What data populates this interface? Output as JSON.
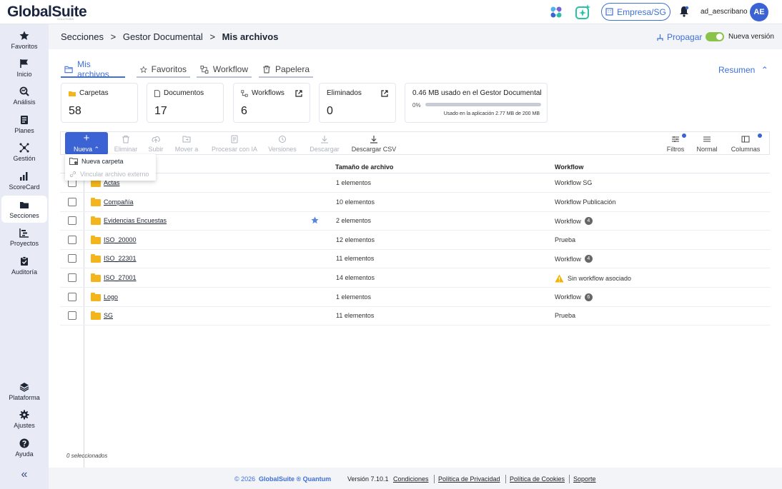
{
  "app": {
    "logo": "GlobalSuite",
    "logo_sub": "SOLUTIONS"
  },
  "topbar": {
    "empresa_label": "Empresa/SG",
    "username": "ad_aescribano",
    "avatar_initials": "AE"
  },
  "sidebar": {
    "items": [
      {
        "label": "Favoritos",
        "icon": "star-icon"
      },
      {
        "label": "Inicio",
        "icon": "flag-icon"
      },
      {
        "label": "Análisis",
        "icon": "analysis-icon"
      },
      {
        "label": "Planes",
        "icon": "plans-icon"
      },
      {
        "label": "Gestión",
        "icon": "management-icon"
      },
      {
        "label": "ScoreCard",
        "icon": "chart-icon"
      },
      {
        "label": "Secciones",
        "icon": "folder-icon"
      },
      {
        "label": "Proyectos",
        "icon": "projects-icon"
      },
      {
        "label": "Auditoría",
        "icon": "audit-icon"
      }
    ],
    "bottom": [
      {
        "label": "Plataforma",
        "icon": "layers-icon"
      },
      {
        "label": "Ajustes",
        "icon": "gear-icon"
      },
      {
        "label": "Ayuda",
        "icon": "help-icon"
      }
    ],
    "collapse_glyph": "«"
  },
  "header": {
    "crumb1": "Secciones",
    "crumb2": "Gestor Documental",
    "crumb3": "Mis archivos",
    "sep": ">",
    "propagar": "Propagar",
    "nueva_version": "Nueva versión"
  },
  "tabs": [
    {
      "label": "Mis archivos"
    },
    {
      "label": "Favoritos"
    },
    {
      "label": "Workflow"
    },
    {
      "label": "Papelera"
    }
  ],
  "resumen": "Resumen",
  "cards": {
    "carpetas": {
      "title": "Carpetas",
      "value": "58"
    },
    "documentos": {
      "title": "Documentos",
      "value": "17"
    },
    "workflows": {
      "title": "Workflows",
      "value": "6"
    },
    "eliminados": {
      "title": "Eliminados",
      "value": "0"
    }
  },
  "usage": {
    "title": "0.46 MB usado en el Gestor Documental",
    "pct": "0%",
    "fraction": 0.0,
    "note": "Usado en la aplicación 2.77 MB de 200 MB"
  },
  "toolbar": {
    "nueva": "Nueva",
    "eliminar": "Eliminar",
    "subir": "Subir",
    "mover": "Mover a",
    "procesar": "Procesar con IA",
    "versiones": "Versiones",
    "descargar": "Descargar",
    "descargar_csv": "Descargar CSV",
    "filtros": "Filtros",
    "normal": "Normal",
    "columnas": "Columnas"
  },
  "dropdown": {
    "nueva_carpeta": "Nueva carpeta",
    "vincular": "Vincular archivo externo"
  },
  "table": {
    "columns": {
      "size": "Tamaño de archivo",
      "workflow": "Workflow"
    },
    "rows": [
      {
        "name": "Actas",
        "size": "1 elementos",
        "workflow": "Workflow SG",
        "badge": ""
      },
      {
        "name": "Compañía",
        "size": "10 elementos",
        "workflow": "Workflow Publicación",
        "badge": ""
      },
      {
        "name": "Evidencias Encuestas",
        "size": "2 elementos",
        "workflow": "Workflow",
        "badge": "4"
      },
      {
        "name": "ISO_20000",
        "size": "12 elementos",
        "workflow": "Prueba",
        "badge": ""
      },
      {
        "name": "ISO_22301",
        "size": "11 elementos",
        "workflow": "Workflow",
        "badge": "4"
      },
      {
        "name": "ISO_27001",
        "size": "14 elementos",
        "workflow": "Sin workflow asociado",
        "badge": ""
      },
      {
        "name": "Logo",
        "size": "1 elementos",
        "workflow": "Workflow",
        "badge": "6"
      },
      {
        "name": "SG",
        "size": "11 elementos",
        "workflow": "Prueba",
        "badge": ""
      }
    ]
  },
  "selected_count": "0 seleccionados",
  "footer": {
    "copyright": "© 2026",
    "brand": "GlobalSuite ® Quantum",
    "version": "Versión 7.10.1",
    "condiciones": "Condiciones",
    "privacidad": "Política de Privacidad",
    "cookies": "Política de Cookies",
    "soporte": "Soporte"
  },
  "colors": {
    "accent": "#3b63d3",
    "link": "#3f6fd8",
    "folder": "#f3b51b",
    "toggle": "#8bc34a",
    "warning": "#f1b400"
  }
}
